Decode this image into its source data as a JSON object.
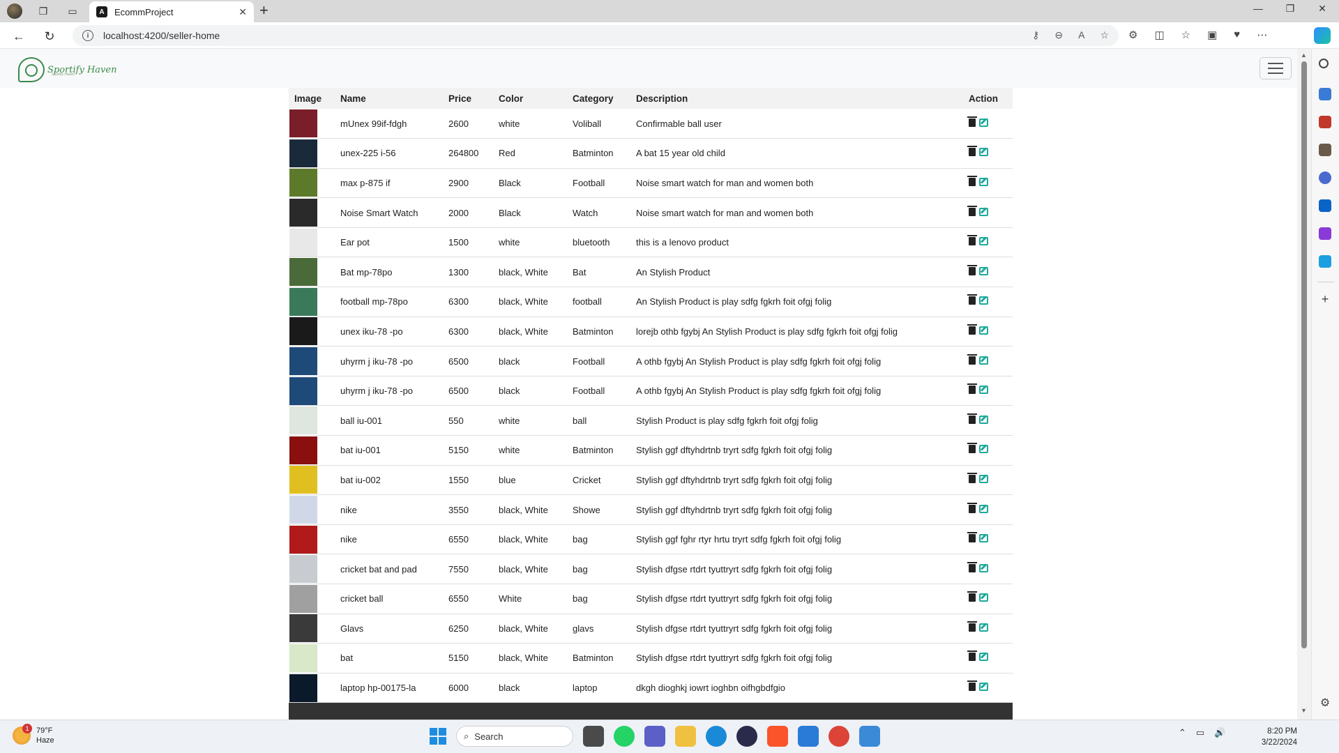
{
  "browser": {
    "tab_title": "EcommProject",
    "tab_icon": "angular-icon",
    "url": "localhost:4200/seller-home"
  },
  "header": {
    "brand_name": "Sportify Haven",
    "brand_tagline": "Sportify Haven"
  },
  "table": {
    "headers": {
      "image": "Image",
      "name": "Name",
      "price": "Price",
      "color": "Color",
      "category": "Category",
      "description": "Description",
      "action": "Action"
    },
    "rows": [
      {
        "name": "mUnex 99if-fdgh",
        "price": "2600",
        "color": "white",
        "category": "Voliball",
        "description": "Confirmable ball user",
        "thumb": "#7a1e2a"
      },
      {
        "name": "unex-225 i-56",
        "price": "264800",
        "color": "Red",
        "category": "Batminton",
        "description": "A bat 15 year old child",
        "thumb": "#1a2a3a"
      },
      {
        "name": "max p-875 if",
        "price": "2900",
        "color": "Black",
        "category": "Football",
        "description": "Noise smart watch for man and women both",
        "thumb": "#5d7a2a"
      },
      {
        "name": "Noise Smart Watch",
        "price": "2000",
        "color": "Black",
        "category": "Watch",
        "description": "Noise smart watch for man and women both",
        "thumb": "#2a2a2a"
      },
      {
        "name": "Ear pot",
        "price": "1500",
        "color": "white",
        "category": "bluetooth",
        "description": "this is a lenovo product",
        "thumb": "#e8e8e8"
      },
      {
        "name": "Bat mp-78po",
        "price": "1300",
        "color": "black, White",
        "category": "Bat",
        "description": "An Stylish Product",
        "thumb": "#4a6a3a"
      },
      {
        "name": "football mp-78po",
        "price": "6300",
        "color": "black, White",
        "category": "football",
        "description": "An Stylish Product is play sdfg fgkrh foit ofgj folig",
        "thumb": "#3a7a5a"
      },
      {
        "name": "unex iku-78 -po",
        "price": "6300",
        "color": "black, White",
        "category": "Batminton",
        "description": "lorejb othb fgybj An Stylish Product is play sdfg fgkrh foit ofgj folig",
        "thumb": "#1a1a1a"
      },
      {
        "name": "uhyrm j iku-78 -po",
        "price": "6500",
        "color": "black",
        "category": "Football",
        "description": "A othb fgybj An Stylish Product is play sdfg fgkrh foit ofgj folig",
        "thumb": "#1e4a7a"
      },
      {
        "name": "uhyrm j iku-78 -po",
        "price": "6500",
        "color": "black",
        "category": "Football",
        "description": "A othb fgybj An Stylish Product is play sdfg fgkrh foit ofgj folig",
        "thumb": "#1e4a7a"
      },
      {
        "name": "ball iu-001",
        "price": "550",
        "color": "white",
        "category": "ball",
        "description": "Stylish Product is play sdfg fgkrh foit ofgj folig",
        "thumb": "#dfe6df"
      },
      {
        "name": "bat iu-001",
        "price": "5150",
        "color": "white",
        "category": "Batminton",
        "description": "Stylish ggf dftyhdrtnb tryrt sdfg fgkrh foit ofgj folig",
        "thumb": "#8a1010"
      },
      {
        "name": "bat iu-002",
        "price": "1550",
        "color": "blue",
        "category": "Cricket",
        "description": "Stylish ggf dftyhdrtnb tryrt sdfg fgkrh foit ofgj folig",
        "thumb": "#e0c020"
      },
      {
        "name": "nike",
        "price": "3550",
        "color": "black, White",
        "category": "Showe",
        "description": "Stylish ggf dftyhdrtnb tryrt sdfg fgkrh foit ofgj folig",
        "thumb": "#d0d8e8"
      },
      {
        "name": "nike",
        "price": "6550",
        "color": "black, White",
        "category": "bag",
        "description": "Stylish ggf fghr rtyr hrtu tryrt sdfg fgkrh foit ofgj folig",
        "thumb": "#b01a1a"
      },
      {
        "name": "cricket bat and pad",
        "price": "7550",
        "color": "black, White",
        "category": "bag",
        "description": "Stylish dfgse rtdrt tyuttryrt sdfg fgkrh foit ofgj folig",
        "thumb": "#c8ccd0"
      },
      {
        "name": "cricket ball",
        "price": "6550",
        "color": "White",
        "category": "bag",
        "description": "Stylish dfgse rtdrt tyuttryrt sdfg fgkrh foit ofgj folig",
        "thumb": "#a0a0a0"
      },
      {
        "name": "Glavs",
        "price": "6250",
        "color": "black, White",
        "category": "glavs",
        "description": "Stylish dfgse rtdrt tyuttryrt sdfg fgkrh foit ofgj folig",
        "thumb": "#3a3a3a"
      },
      {
        "name": "bat",
        "price": "5150",
        "color": "black, White",
        "category": "Batminton",
        "description": "Stylish dfgse rtdrt tyuttryrt sdfg fgkrh foit ofgj folig",
        "thumb": "#d8e8c8"
      },
      {
        "name": "laptop hp-00175-la",
        "price": "6000",
        "color": "black",
        "category": "laptop",
        "description": "dkgh dioghkj iowrt ioghbn oifhgbdfgio",
        "thumb": "#0a1a2a"
      }
    ]
  },
  "taskbar": {
    "weather_temp": "79°F",
    "weather_desc": "Haze",
    "weather_badge": "1",
    "search_placeholder": "Search",
    "time": "8:20 PM",
    "date": "3/22/2024"
  },
  "colors": {
    "accent_edit": "#1fa89a",
    "footer_bar": "#333333",
    "brand_green": "#3a8a4a"
  }
}
